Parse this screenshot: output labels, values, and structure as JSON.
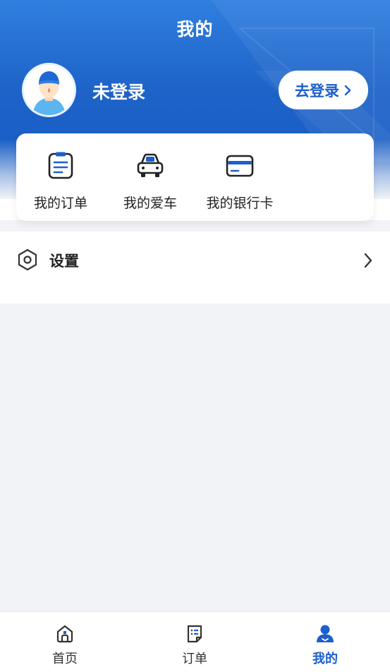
{
  "header": {
    "title": "我的"
  },
  "user": {
    "name": "未登录",
    "login_label": "去登录"
  },
  "quick_actions": [
    {
      "label": "我的订单",
      "icon": "order-list-icon"
    },
    {
      "label": "我的爱车",
      "icon": "car-icon"
    },
    {
      "label": "我的银行卡",
      "icon": "bank-card-icon"
    }
  ],
  "settings": {
    "label": "设置",
    "icon": "hexagon-settings-icon"
  },
  "tabbar": {
    "items": [
      {
        "label": "首页",
        "icon": "home-icon",
        "active": false
      },
      {
        "label": "订单",
        "icon": "order-icon",
        "active": false
      },
      {
        "label": "我的",
        "icon": "user-icon",
        "active": true
      }
    ]
  },
  "colors": {
    "accent": "#1d5fcc",
    "header_blue": "#1e63c8",
    "background": "#f2f3f7"
  }
}
